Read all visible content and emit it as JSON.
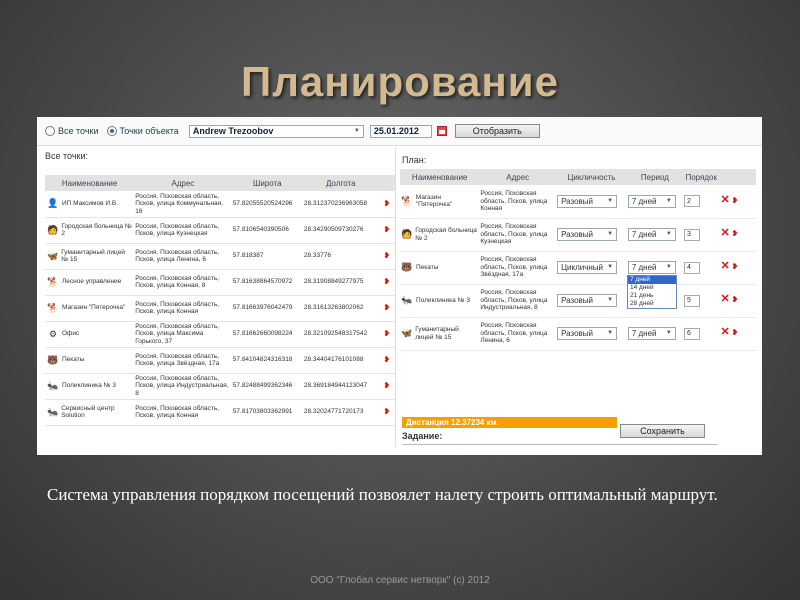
{
  "slide_title": "Планирование",
  "caption": "Система управления порядком посещений позвоялет налету строить оптимальный маршрут.",
  "footer": "ООО \"Глобал сервис нетворк\" (с) 2012",
  "topbar": {
    "radio_all": "Все точки",
    "radio_object": "Точки объекта",
    "radio_selected": "Точки объекта",
    "user": "Andrew Trezoobov",
    "date": "25.01.2012",
    "show_button": "Отобразить"
  },
  "left": {
    "title": "Все точки:",
    "columns": [
      "Наименование",
      "Адрес",
      "Широта",
      "Долгота"
    ],
    "rows": [
      {
        "icon": "person-icon",
        "name": "ИП Максимов И.В.",
        "address": "Россия, Псковская область, Псков, улица Коммунальная, 16",
        "lat": "57.82055520524296",
        "lon": "28.312370236963058"
      },
      {
        "icon": "doctor-icon",
        "name": "Городская больница № 2",
        "address": "Россия, Псковская область, Псков, улица Кузнецкая",
        "lat": "57.8106540390506",
        "lon": "28.34290509730276"
      },
      {
        "icon": "butterfly-icon",
        "name": "Гуманитарный лицей № 15",
        "address": "Россия, Псковская область, Псков, улица Ленина, 6",
        "lat": "57.818387",
        "lon": "28.33776"
      },
      {
        "icon": "dog-icon",
        "name": "Лесное управление",
        "address": "Россия, Псковская область, Псков, улица Конная, 8",
        "lat": "57.81638864570972",
        "lon": "28.31908849277975"
      },
      {
        "icon": "dog-icon",
        "name": "Магазин \"Пятерочка\"",
        "address": "Россия, Псковская область, Псков, улица Конная",
        "lat": "57.81663976042479",
        "lon": "28.31613263802062"
      },
      {
        "icon": "cog-icon",
        "name": "Офис",
        "address": "Россия, Псковская область, Псков, улица Максима Горького, 37",
        "lat": "57.81662660098224",
        "lon": "28.321092548317542"
      },
      {
        "icon": "bear-icon",
        "name": "Пекаты",
        "address": "Россия, Псковская область, Псков, улица Звёздная, 17а",
        "lat": "57.84104824316318",
        "lon": "28.34404176101088"
      },
      {
        "icon": "ant-icon",
        "name": "Поликлиника № 3",
        "address": "Россия, Псковская область, Псков, улица Индустриальная, 8",
        "lat": "57.82488499362346",
        "lon": "28.369184944123047"
      },
      {
        "icon": "ant-icon",
        "name": "Сервисный центр Solution",
        "address": "Россия, Псковская область, Псков, улица Конная",
        "lat": "57.81703803362991",
        "lon": "28.32024771720173"
      }
    ]
  },
  "right": {
    "title": "План:",
    "columns": [
      "Наименование",
      "Адрес",
      "Цикличность",
      "Период",
      "Порядок"
    ],
    "rows": [
      {
        "icon": "dog-icon",
        "name": "Магазин \"Пятерочка\"",
        "address": "Россия, Псковская область, Псков, улица Конная",
        "cyclicity": "Разовый",
        "period": "7 дней",
        "order": "2"
      },
      {
        "icon": "doctor-icon",
        "name": "Городская больница № 2",
        "address": "Россия, Псковская область, Псков, улица Кузнецкая",
        "cyclicity": "Разовый",
        "period": "7 дней",
        "order": "3"
      },
      {
        "icon": "bear-icon",
        "name": "Пекаты",
        "address": "Россия, Псковская область, Псков, улица Звёздная, 17а",
        "cyclicity": "Цикличный",
        "period": "7 дней",
        "order": "4"
      },
      {
        "icon": "ant-icon",
        "name": "Поликлиника № 3",
        "address": "Россия, Псковская область, Псков, улица Индустриальная, 8",
        "cyclicity": "Разовый",
        "period": "7 дней",
        "order": "5"
      },
      {
        "icon": "butterfly-icon",
        "name": "Гуманитарный лицей № 15",
        "address": "Россия, Псковская область, Псков, улица Ленина, 6",
        "cyclicity": "Разовый",
        "period": "7 дней",
        "order": "6"
      }
    ],
    "period_options": [
      "7 дней",
      "14 дней",
      "21 день",
      "28 дней"
    ],
    "period_selected": "7 дней"
  },
  "distance": "Дистанция 12.37234 км.",
  "save_button": "Сохранить",
  "task_label": "Задание:"
}
